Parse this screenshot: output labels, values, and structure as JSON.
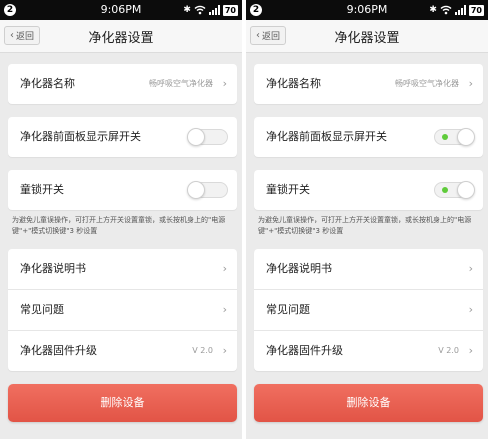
{
  "screens": [
    {
      "id": "left",
      "status": {
        "notif_count": "2",
        "time": "9:06PM",
        "battery": "70"
      },
      "nav": {
        "back_label": "返回",
        "title": "净化器设置"
      },
      "name_row": {
        "label": "净化器名称",
        "value": "畅呼吸空气净化器"
      },
      "display_switch": {
        "label": "净化器前面板显示屏开关",
        "on": false
      },
      "child_lock": {
        "label": "童锁开关",
        "on": false
      },
      "child_lock_note": "为避免儿童误操作，可打开上方开关设置童锁，或长按机身上的\"电源键\"+\"模式切换键\"3 秒设置",
      "menu": [
        {
          "label": "净化器说明书",
          "value": ""
        },
        {
          "label": "常见问题",
          "value": ""
        },
        {
          "label": "净化器固件升级",
          "value": "V 2.0"
        }
      ],
      "delete_label": "删除设备"
    },
    {
      "id": "right",
      "status": {
        "notif_count": "2",
        "time": "9:06PM",
        "battery": "70"
      },
      "nav": {
        "back_label": "返回",
        "title": "净化器设置"
      },
      "name_row": {
        "label": "净化器名称",
        "value": "畅呼吸空气净化器"
      },
      "display_switch": {
        "label": "净化器前面板显示屏开关",
        "on": true
      },
      "child_lock": {
        "label": "童锁开关",
        "on": true
      },
      "child_lock_note": "为避免儿童误操作，可打开上方开关设置童锁，或长按机身上的\"电源键\"+\"模式切换键\"3 秒设置",
      "menu": [
        {
          "label": "净化器说明书",
          "value": ""
        },
        {
          "label": "常见问题",
          "value": ""
        },
        {
          "label": "净化器固件升级",
          "value": "V 2.0"
        }
      ],
      "delete_label": "删除设备"
    }
  ],
  "colors": {
    "delete_button": "#e85c4d",
    "toggle_on_dot": "#5fcb3a",
    "page_bg": "#ebebeb",
    "status_bar": "#0c0c0c"
  },
  "icons": {
    "back": "chevron-left-icon",
    "row_arrow": "chevron-right-icon",
    "bluetooth": "bluetooth-icon",
    "wifi": "wifi-icon",
    "signal": "signal-icon",
    "battery": "battery-icon"
  }
}
